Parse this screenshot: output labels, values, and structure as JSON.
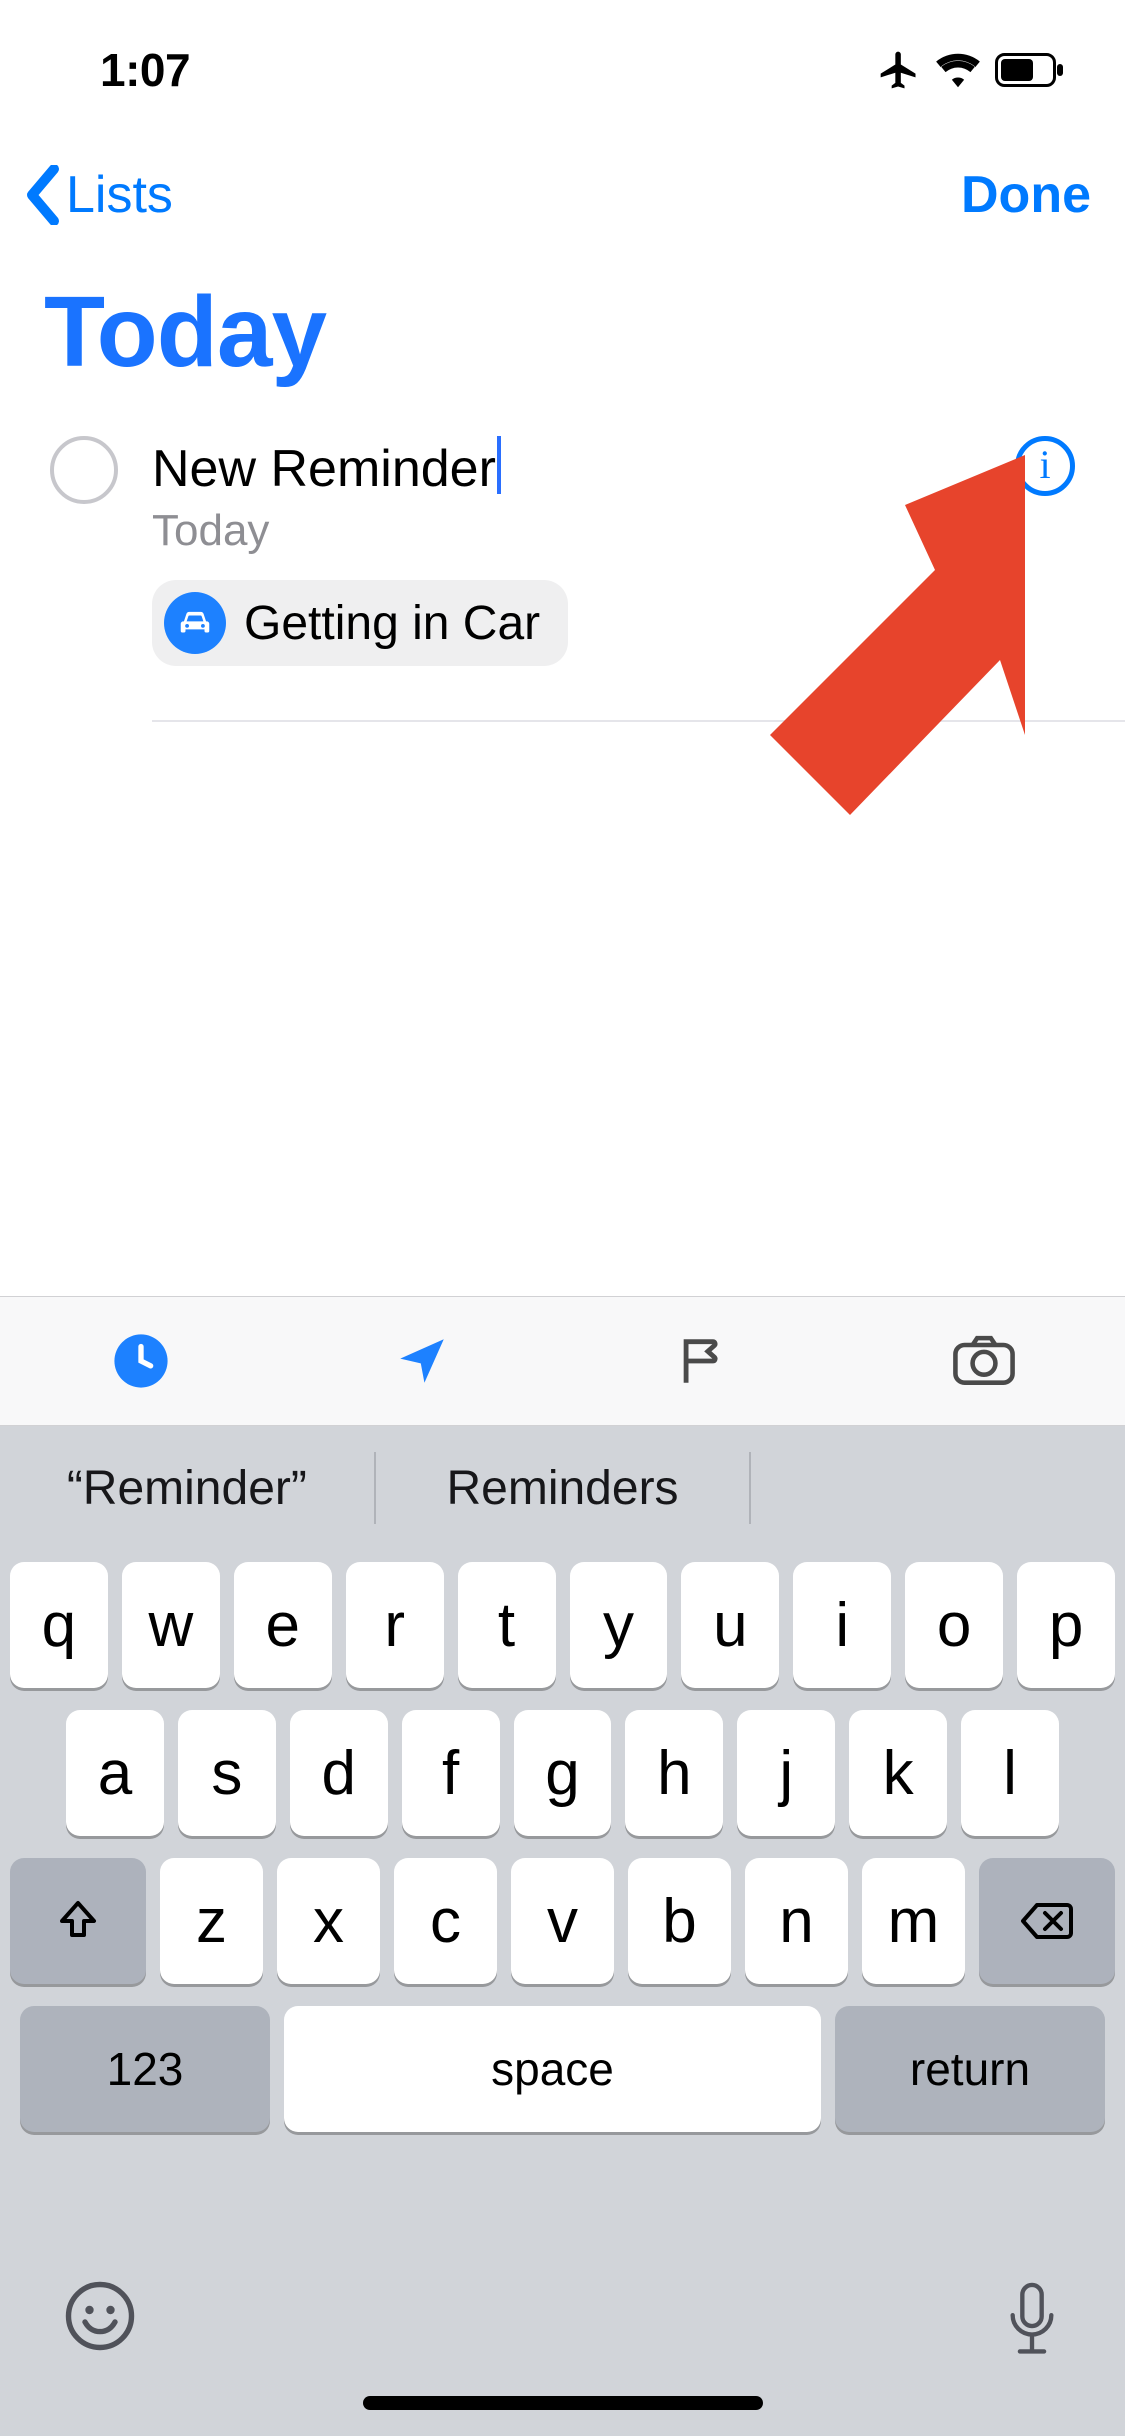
{
  "status": {
    "time": "1:07"
  },
  "nav": {
    "back_label": "Lists",
    "done_label": "Done"
  },
  "page": {
    "title": "Today"
  },
  "reminder": {
    "title": "New Reminder",
    "subtitle": "Today",
    "chip_label": "Getting in Car"
  },
  "keyboard": {
    "suggestions": [
      "“Reminder”",
      "Reminders"
    ],
    "row1": [
      "q",
      "w",
      "e",
      "r",
      "t",
      "y",
      "u",
      "i",
      "o",
      "p"
    ],
    "row2": [
      "a",
      "s",
      "d",
      "f",
      "g",
      "h",
      "j",
      "k",
      "l"
    ],
    "row3": [
      "z",
      "x",
      "c",
      "v",
      "b",
      "n",
      "m"
    ],
    "numbers_label": "123",
    "space_label": "space",
    "return_label": "return"
  }
}
